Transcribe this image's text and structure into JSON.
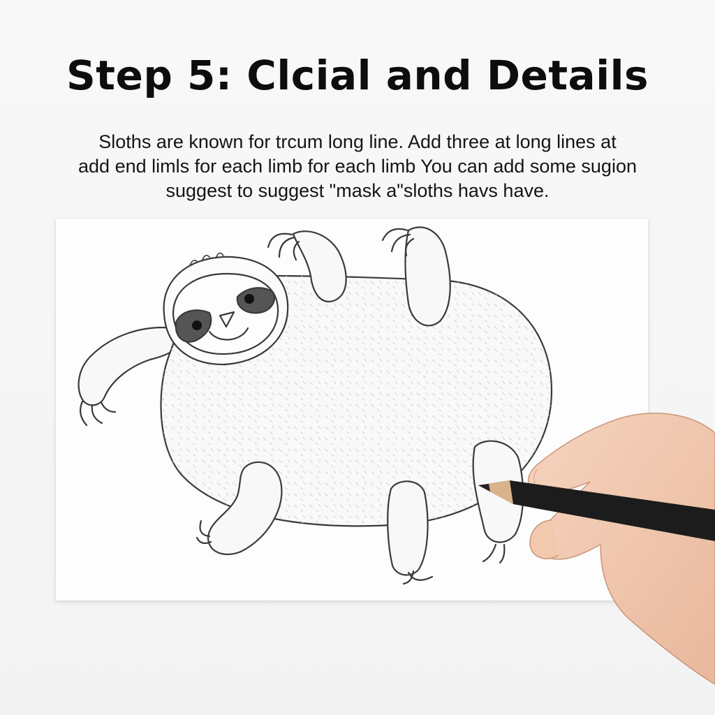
{
  "title": "Step 5: Clcial and Details",
  "instructions": {
    "line1": "Sloths are known for trcum long line. Add three at long lines at",
    "line2": "add end limls for each limb for each limb You can add some sugion",
    "line3": "suggest to suggest \"mask a\"sloths havs have."
  },
  "colors": {
    "background": "#f6f6f6",
    "paper": "#fdfdfd",
    "ink": "#3a3a3a",
    "mask": "#555555",
    "skin": "#f2c9b1",
    "pencil": "#1c1c1c"
  }
}
